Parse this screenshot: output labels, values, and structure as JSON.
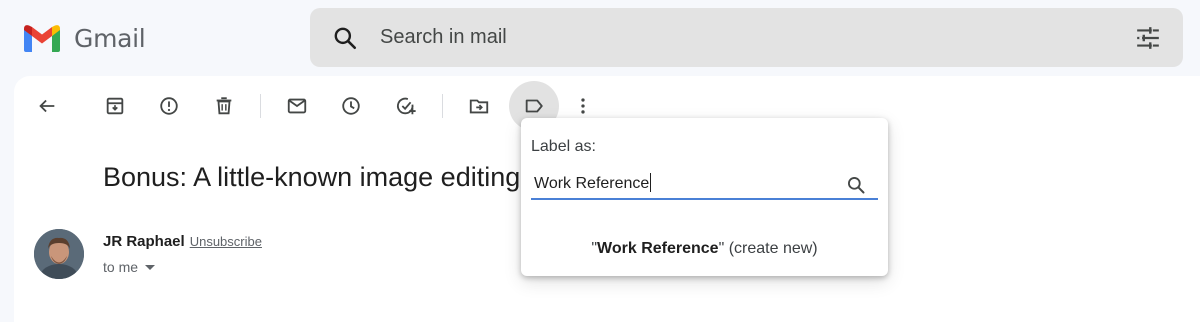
{
  "app": {
    "name": "Gmail"
  },
  "search": {
    "placeholder": "Search in mail"
  },
  "toolbar": {
    "items": [
      "back-arrow-icon",
      "archive-icon",
      "report-spam-icon",
      "delete-icon",
      "mark-unread-icon",
      "snooze-icon",
      "add-task-icon",
      "move-to-icon",
      "label-icon",
      "more-icon"
    ]
  },
  "email": {
    "subject": "Bonus: A little-known image editing",
    "sender_name": "JR Raphael",
    "unsubscribe": "Unsubscribe",
    "recipient": "to me"
  },
  "label_popup": {
    "title": "Label as:",
    "input_value": "Work Reference",
    "create_quote_open": "\"",
    "create_name": "Work Reference",
    "create_suffix": "\" (create new)"
  },
  "colors": {
    "background": "#f6f8fc",
    "search_bg": "#e3e3e3",
    "input_underline": "#4a80d6",
    "gmail_red": "#ea4335",
    "gmail_blue": "#4285f4",
    "gmail_green": "#34a853",
    "gmail_yellow": "#fbbc04"
  }
}
